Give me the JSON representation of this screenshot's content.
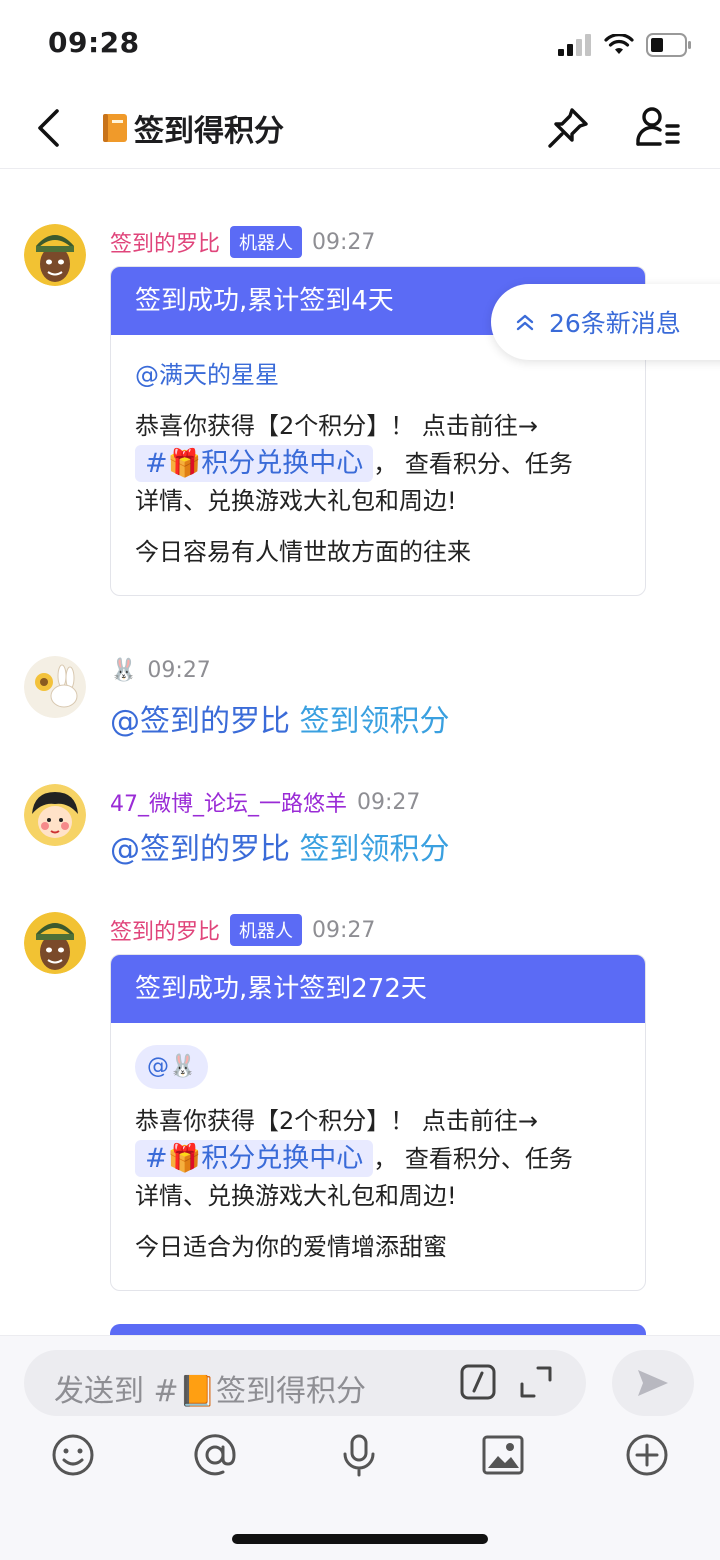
{
  "status_bar": {
    "time": "09:28"
  },
  "header": {
    "title": "签到得积分",
    "title_icon": "orange-book-emoji"
  },
  "peek_text": "@签到的罗比 签到领积分",
  "new_messages": {
    "label": "26条新消息"
  },
  "messages": [
    {
      "sender": "签到的罗比",
      "badge": "机器人",
      "time": "09:27",
      "card_title": "签到成功,累计签到4天",
      "mention": "@满天的星星",
      "line1": "恭喜你获得【2个积分】！ 点击前往→",
      "channel": "#🎁积分兑换中心",
      "line2_suffix": "， 查看积分、任务",
      "line3": "详情、兑换游戏大礼包和周边!",
      "fortune": "今日容易有人情世故方面的往来"
    },
    {
      "sender": "🐰",
      "time": "09:27",
      "at": "@签到的罗比",
      "text": "签到领积分"
    },
    {
      "sender": "47_微博_论坛_一路悠羊",
      "time": "09:27",
      "at": "@签到的罗比",
      "text": "签到领积分"
    },
    {
      "sender": "签到的罗比",
      "badge": "机器人",
      "time": "09:27",
      "card_title": "签到成功,累计签到272天",
      "mention": "@🐰",
      "line1": "恭喜你获得【2个积分】！ 点击前往→",
      "channel": "#🎁积分兑换中心",
      "line2_suffix": "， 查看积分、任务",
      "line3": "详情、兑换游戏大礼包和周边!",
      "fortune": "今日适合为你的爱情增添甜蜜"
    }
  ],
  "composer": {
    "placeholder": "发送到 #📙签到得积分"
  },
  "colors": {
    "accent": "#5b6bf5",
    "link": "#3a6bd8",
    "bot_name": "#e0457b",
    "user_name": "#9a2bd6"
  }
}
